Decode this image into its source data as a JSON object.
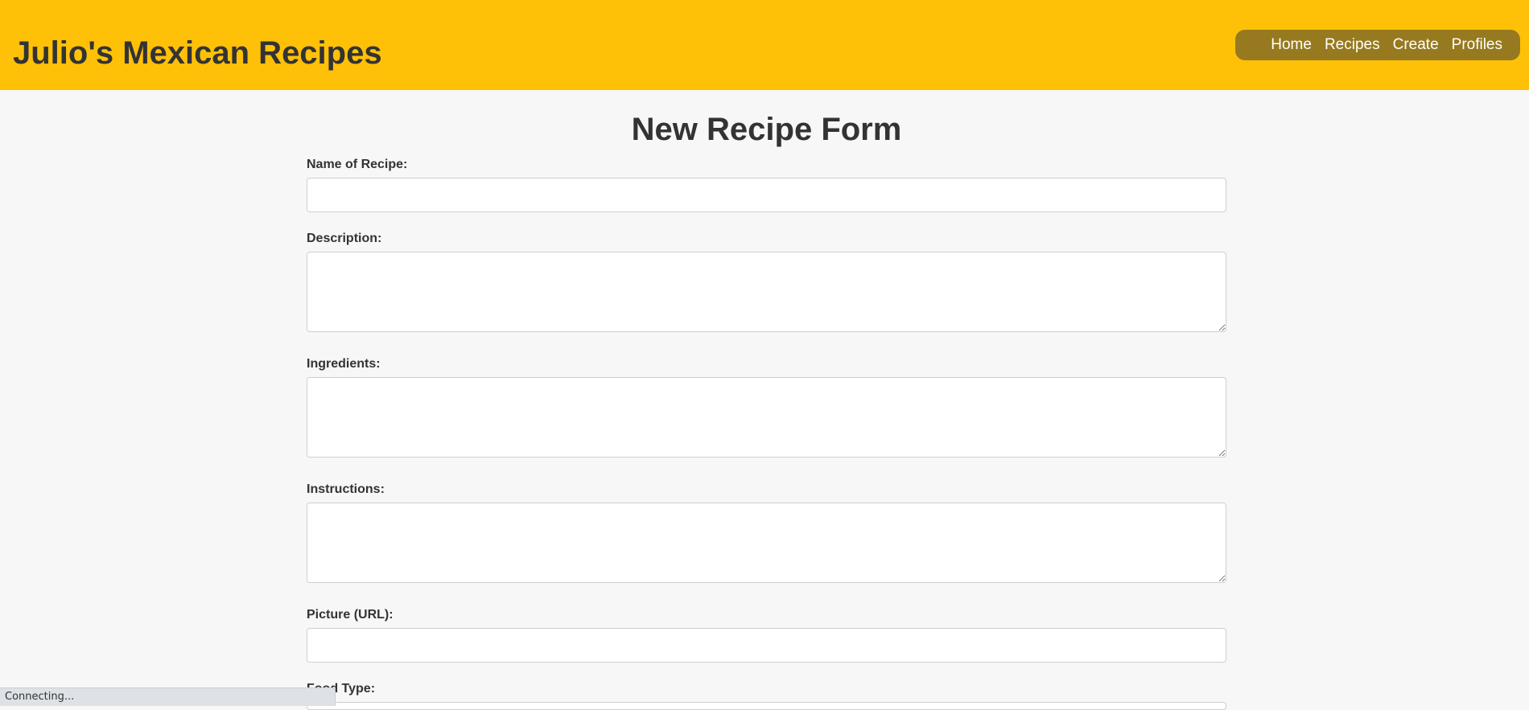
{
  "header": {
    "site_title": "Julio's Mexican Recipes",
    "nav": {
      "home": "Home",
      "recipes": "Recipes",
      "create": "Create",
      "profiles": "Profiles"
    }
  },
  "form": {
    "title": "New Recipe Form",
    "fields": {
      "name": {
        "label": "Name of Recipe:",
        "value": ""
      },
      "description": {
        "label": "Description:",
        "value": ""
      },
      "ingredients": {
        "label": "Ingredients:",
        "value": ""
      },
      "instructions": {
        "label": "Instructions:",
        "value": ""
      },
      "picture": {
        "label": "Picture (URL):",
        "value": ""
      },
      "food_type": {
        "label": "Food Type:"
      }
    }
  },
  "status_bar": {
    "text": "Connecting..."
  },
  "colors": {
    "header_bg": "#ffc107",
    "nav_bg": "#977a1f",
    "page_bg": "#f7f7f7",
    "text": "#333333"
  }
}
